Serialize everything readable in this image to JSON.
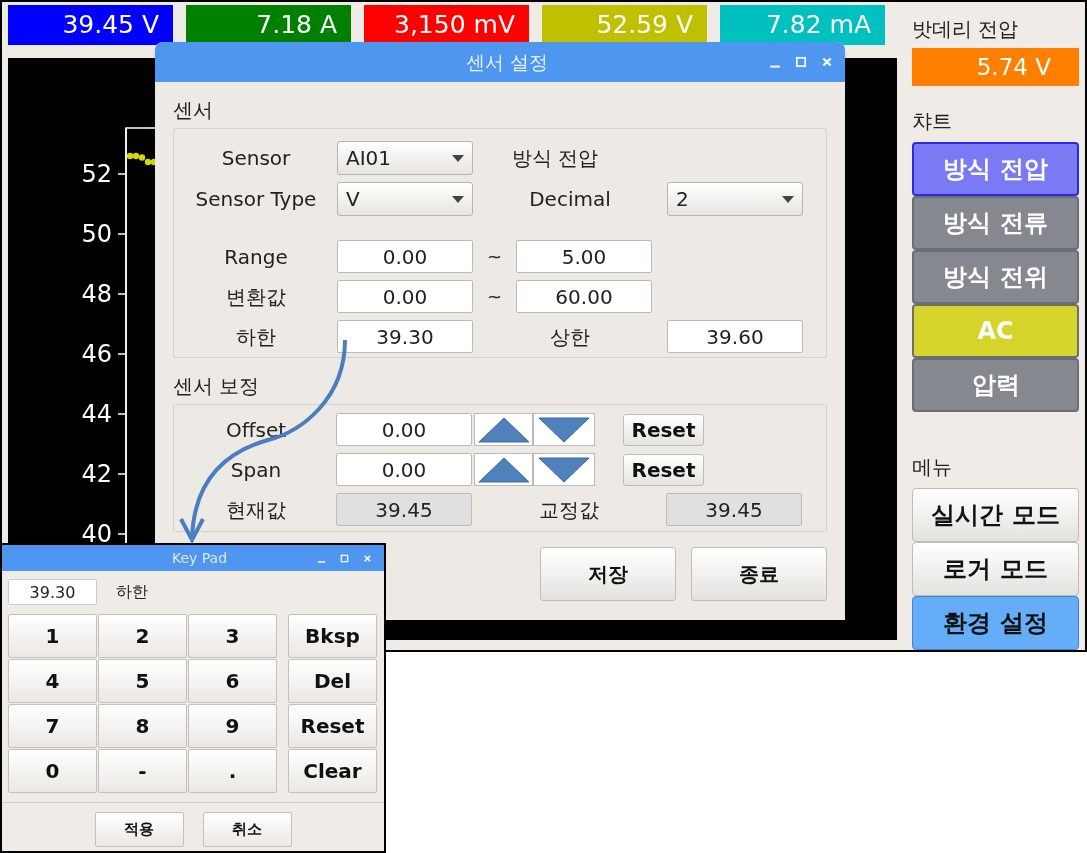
{
  "readouts": [
    {
      "value": "39.45 V",
      "color": "#0000ff"
    },
    {
      "value": "7.18 A",
      "color": "#008000"
    },
    {
      "value": "3,150 mV",
      "color": "#ff0000"
    },
    {
      "value": "52.59 V",
      "color": "#c0c000"
    },
    {
      "value": "7.82 mA",
      "color": "#00c0c0"
    }
  ],
  "chart": {
    "y_axis_labels": [
      "52",
      "50",
      "48",
      "46",
      "44",
      "42",
      "40"
    ]
  },
  "battery": {
    "label": "밧데리 전압",
    "value": "5.74 V"
  },
  "chart_buttons": {
    "label": "챠트",
    "items": [
      {
        "label": "방식 전압",
        "color": "#7a7af5",
        "selected": true
      },
      {
        "label": "방식 전류",
        "color": "#85898f",
        "selected": false
      },
      {
        "label": "방식 전위",
        "color": "#85898f",
        "selected": false
      },
      {
        "label": "AC",
        "color": "#d4d42a",
        "selected": false
      },
      {
        "label": "압력",
        "color": "#85898f",
        "selected": false
      }
    ]
  },
  "menu": {
    "label": "메뉴",
    "items": [
      {
        "label": "실시간 모드",
        "selected": false
      },
      {
        "label": "로거 모드",
        "selected": false
      },
      {
        "label": "환경 설정",
        "selected": true
      }
    ]
  },
  "sensor_dialog": {
    "title": "센서 설정",
    "sensor_section": {
      "title": "센서",
      "sensor": {
        "label": "Sensor",
        "value": "AI01"
      },
      "mode_text": "방식 전압",
      "sensor_type": {
        "label": "Sensor Type",
        "value": "V"
      },
      "decimal": {
        "label": "Decimal",
        "value": "2"
      },
      "range": {
        "label": "Range",
        "from": "0.00",
        "separator": "~",
        "to": "5.00"
      },
      "conversion": {
        "label": "변환값",
        "from": "0.00",
        "separator": "~",
        "to": "60.00"
      },
      "lower": {
        "label": "하한",
        "value": "39.30"
      },
      "upper": {
        "label": "상한",
        "value": "39.60"
      }
    },
    "calibration_section": {
      "title": "센서 보정",
      "adjust_rows": [
        {
          "label": "Offset",
          "value": "0.00",
          "reset": "Reset"
        },
        {
          "label": "Span",
          "value": "0.00",
          "reset": "Reset"
        }
      ],
      "current": {
        "label": "현재값",
        "value": "39.45"
      },
      "corrected": {
        "label": "교정값",
        "value": "39.45"
      }
    },
    "buttons": [
      "저장",
      "종료"
    ]
  },
  "keypad": {
    "title": "Key Pad",
    "value": "39.30",
    "field_label": "하한",
    "keys": [
      [
        "1",
        "2",
        "3",
        "Bksp"
      ],
      [
        "4",
        "5",
        "6",
        "Del"
      ],
      [
        "7",
        "8",
        "9",
        "Reset"
      ],
      [
        "0",
        "-",
        ".",
        "Clear"
      ]
    ],
    "buttons": [
      "적용",
      "취소"
    ]
  }
}
